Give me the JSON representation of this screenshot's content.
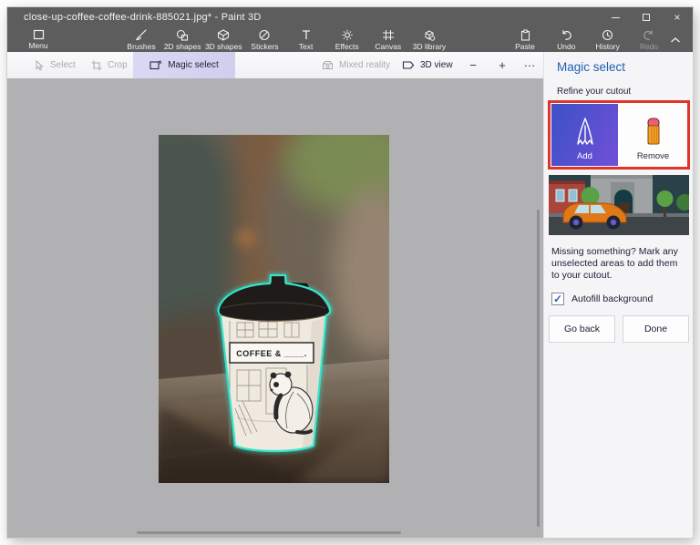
{
  "window": {
    "title": "close-up-coffee-coffee-drink-885021.jpg* - Paint 3D",
    "controls": {
      "close_glyph": "×"
    }
  },
  "ribbon": {
    "menu": {
      "label": "Menu"
    },
    "tools": [
      {
        "label": "Brushes",
        "icon": "brush-icon"
      },
      {
        "label": "2D shapes",
        "icon": "shapes-2d-icon"
      },
      {
        "label": "3D shapes",
        "icon": "shapes-3d-icon"
      },
      {
        "label": "Stickers",
        "icon": "sticker-icon"
      },
      {
        "label": "Text",
        "icon": "text-icon"
      },
      {
        "label": "Effects",
        "icon": "effects-icon"
      },
      {
        "label": "Canvas",
        "icon": "canvas-icon"
      },
      {
        "label": "3D library",
        "icon": "library-3d-icon"
      }
    ],
    "clipboard": [
      {
        "label": "Paste",
        "icon": "paste-icon",
        "enabled": true
      },
      {
        "label": "Undo",
        "icon": "undo-icon",
        "enabled": true
      },
      {
        "label": "History",
        "icon": "history-icon",
        "enabled": true
      },
      {
        "label": "Redo",
        "icon": "redo-icon",
        "enabled": false
      }
    ]
  },
  "toolbar": {
    "select": "Select",
    "crop": "Crop",
    "magic_select": "Magic select",
    "mixed_reality": "Mixed reality",
    "view_3d": "3D view",
    "zoom_out": "−",
    "zoom_in": "+",
    "more": "…"
  },
  "panel": {
    "title": "Magic select",
    "refine": "Refine your cutout",
    "add": "Add",
    "remove": "Remove",
    "missing": "Missing something? Mark any unselected areas to add them to your cutout.",
    "autofill": "Autofill background",
    "autofill_checked": true,
    "check_glyph": "✓",
    "go_back": "Go back",
    "done": "Done"
  },
  "annotation": {
    "highlight_color": "#e0332a"
  },
  "canvas_image": {
    "cup_text": "COFFEE & ____.",
    "selection_color": "#35e2ca"
  },
  "colors": {
    "titlebar": "#5d5d5d",
    "canvas_bg": "#b1b1b3",
    "panel_bg": "#f5f5f7",
    "accent_blue": "#1e5fb4",
    "add_gradient_start": "#3b51c6",
    "add_gradient_end": "#7250d8"
  }
}
